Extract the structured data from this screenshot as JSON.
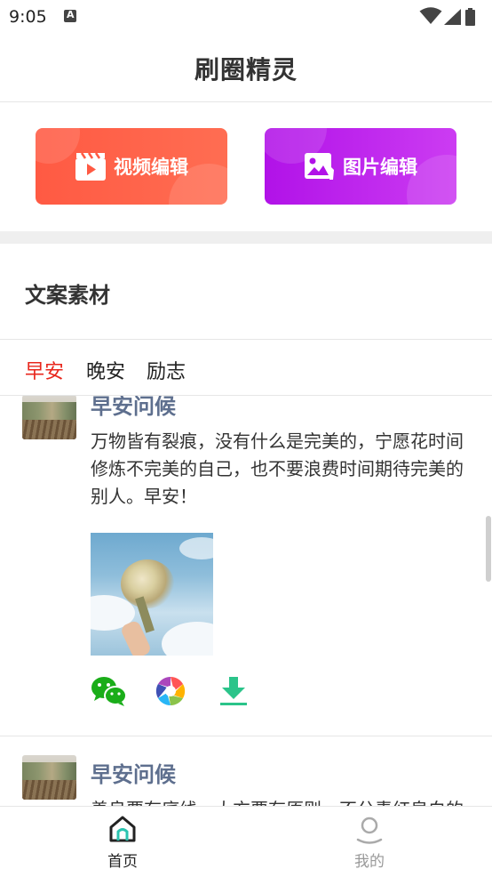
{
  "status_bar": {
    "time": "9:05",
    "icons": [
      "a-notification-icon",
      "wifi-icon",
      "signal-icon",
      "battery-icon"
    ]
  },
  "header": {
    "title": "刷圈精灵"
  },
  "actions": [
    {
      "label": "视频编辑",
      "icon": "video-clapper-icon",
      "color": "#ff5a43"
    },
    {
      "label": "图片编辑",
      "icon": "image-edit-icon",
      "color": "#b112e8"
    }
  ],
  "section": {
    "title": "文案素材"
  },
  "tabs": [
    {
      "label": "早安",
      "active": true
    },
    {
      "label": "晚安",
      "active": false
    },
    {
      "label": "励志",
      "active": false
    }
  ],
  "posts": [
    {
      "title": "早安问候",
      "text": "万物皆有裂痕，没有什么是完美的，宁愿花时间修炼不完美的自己，也不要浪费时间期待完美的别人。早安！",
      "share_icons": [
        "wechat-icon",
        "moments-icon",
        "download-icon"
      ]
    },
    {
      "title": "早安问候",
      "text": "善良要有底线，大方要有原则，不分青红皂白的付出，只会让人得寸进尺。早安！"
    }
  ],
  "bottom_nav": [
    {
      "label": "首页",
      "icon": "home-icon",
      "active": true
    },
    {
      "label": "我的",
      "icon": "profile-icon",
      "active": false
    }
  ],
  "colors": {
    "accent_red": "#e8271d",
    "title_blue": "#5e6f8e",
    "download_green": "#2bc48a",
    "wechat_green": "#1aad19"
  }
}
